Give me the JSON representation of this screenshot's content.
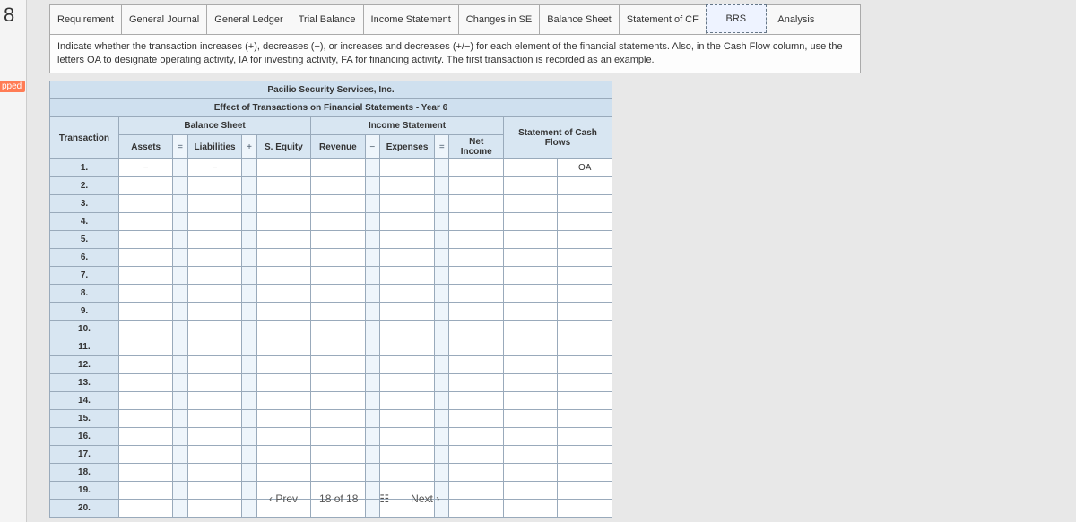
{
  "left_marker": "8",
  "side_tag": "pped",
  "tabs": [
    "Requirement",
    "General Journal",
    "General Ledger",
    "Trial Balance",
    "Income Statement",
    "Changes in SE",
    "Balance Sheet",
    "Statement of CF",
    "BRS",
    "Analysis"
  ],
  "instructions": "Indicate whether the transaction increases (+), decreases (−), or increases and decreases (+/−) for each element of the financial statements. Also, in the Cash Flow column, use the letters OA to designate operating activity, IA for investing activity, FA for financing activity. The first transaction is recorded as an example.",
  "ws": {
    "title": "Pacilio Security Services, Inc.",
    "subtitle": "Effect of Transactions on Financial Statements - Year 6",
    "group_bs": "Balance Sheet",
    "group_is": "Income Statement",
    "group_cf": "Statement of Cash Flows",
    "col_txn": "Transaction",
    "col_assets": "Assets",
    "col_liab": "Liabilities",
    "col_se": "S. Equity",
    "col_rev": "Revenue",
    "col_exp": "Expenses",
    "col_ni": "Net Income",
    "eq": "=",
    "plus": "+",
    "minus": "−",
    "rows": [
      "1.",
      "2.",
      "3.",
      "4.",
      "5.",
      "6.",
      "7.",
      "8.",
      "9.",
      "10.",
      "11.",
      "12.",
      "13.",
      "14.",
      "15.",
      "16.",
      "17.",
      "18.",
      "19.",
      "20."
    ],
    "r1_assets": "−",
    "r1_liab": "−",
    "r1_cf_v": "",
    "r1_cf_t": "OA"
  },
  "nav": {
    "prev": "Prev",
    "pos": "18 of 18",
    "next": "Next"
  }
}
